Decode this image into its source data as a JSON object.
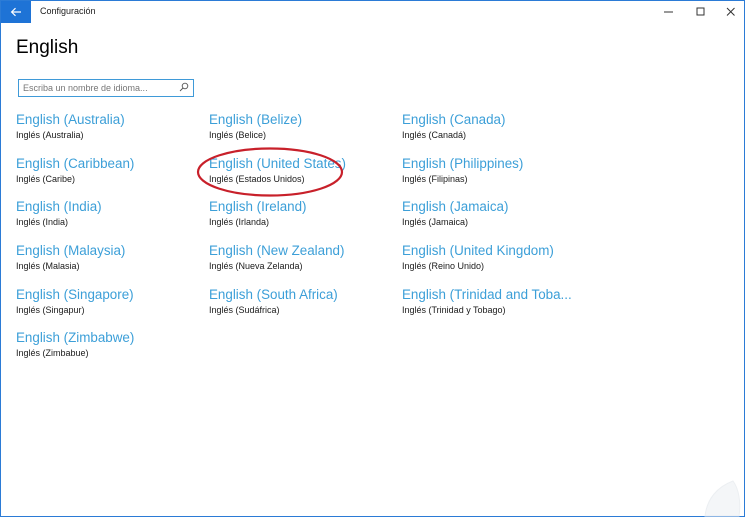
{
  "window": {
    "title": "Configuración",
    "accent_color": "#1e73d6"
  },
  "icons": {
    "back": "arrow-left-icon",
    "minimize": "minimize-icon",
    "maximize": "maximize-icon",
    "close": "close-icon",
    "search": "search-icon"
  },
  "page": {
    "title": "English"
  },
  "search": {
    "placeholder": "Escriba un nombre de idioma..."
  },
  "link_color": "#3c9fd8",
  "highlight_color": "#c8202a",
  "languages": [
    {
      "name": "English (Australia)",
      "local": "Inglés (Australia)"
    },
    {
      "name": "English (Belize)",
      "local": "Inglés (Belice)"
    },
    {
      "name": "English (Canada)",
      "local": "Inglés (Canadá)"
    },
    {
      "name": "English (Caribbean)",
      "local": "Inglés (Caribe)"
    },
    {
      "name": "English (United States)",
      "local": "Inglés (Estados Unidos)",
      "highlighted": true
    },
    {
      "name": "English (Philippines)",
      "local": "Inglés (Filipinas)"
    },
    {
      "name": "English (India)",
      "local": "Inglés (India)"
    },
    {
      "name": "English (Ireland)",
      "local": "Inglés (Irlanda)"
    },
    {
      "name": "English (Jamaica)",
      "local": "Inglés (Jamaica)"
    },
    {
      "name": "English (Malaysia)",
      "local": "Inglés (Malasia)"
    },
    {
      "name": "English (New Zealand)",
      "local": "Inglés (Nueva Zelanda)"
    },
    {
      "name": "English (United Kingdom)",
      "local": "Inglés (Reino Unido)"
    },
    {
      "name": "English (Singapore)",
      "local": "Inglés (Singapur)"
    },
    {
      "name": "English (South Africa)",
      "local": "Inglés (Sudáfrica)"
    },
    {
      "name": "English (Trinidad and Toba...",
      "local": "Inglés (Trinidad y Tobago)"
    },
    {
      "name": "English (Zimbabwe)",
      "local": "Inglés (Zimbabue)"
    }
  ]
}
